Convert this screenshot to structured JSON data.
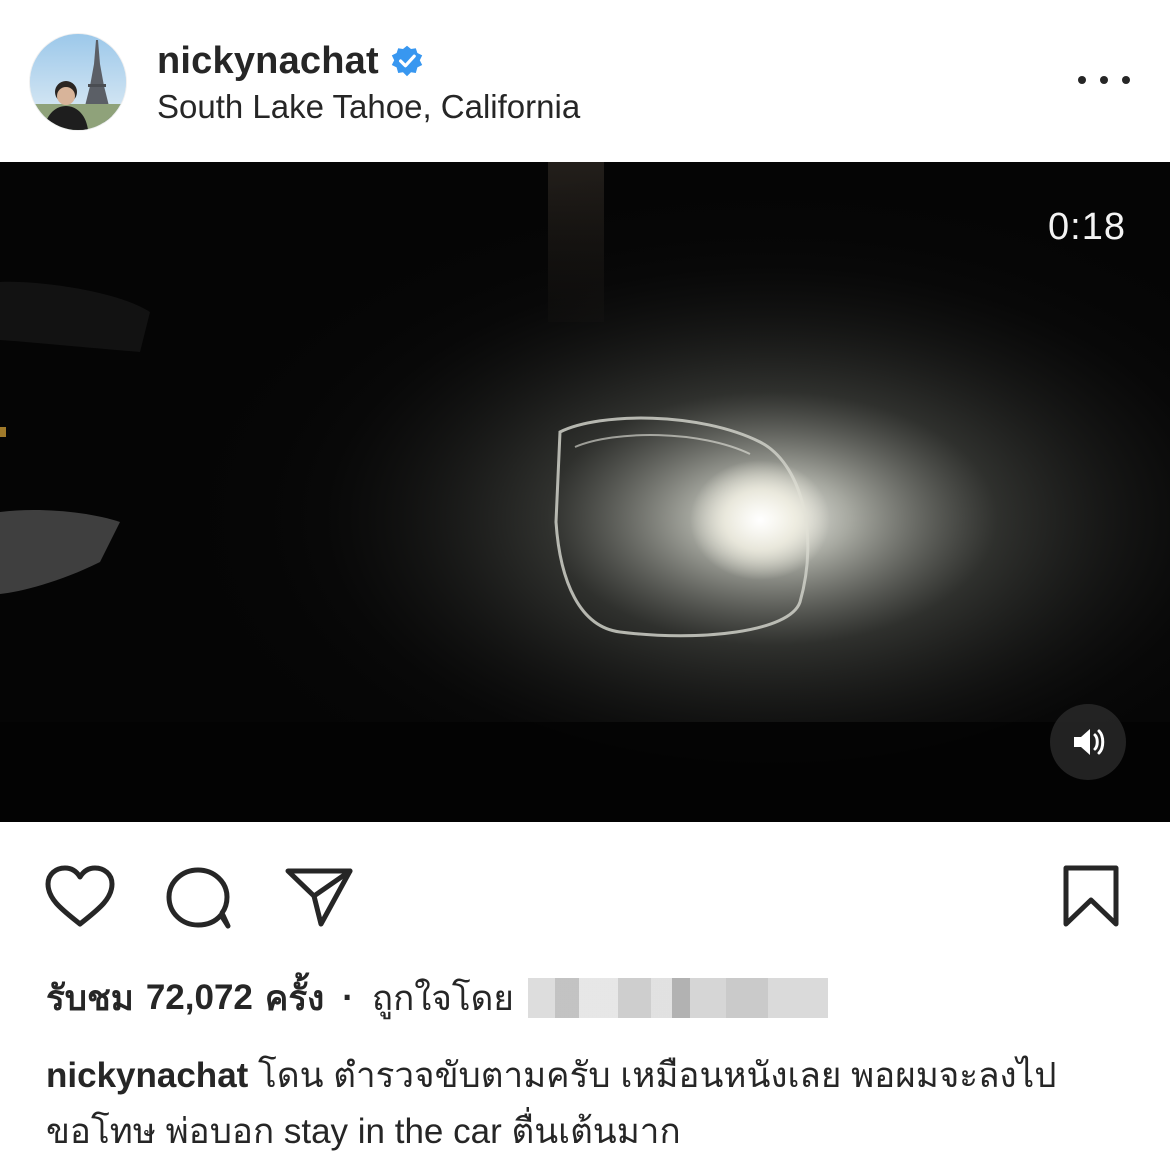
{
  "post": {
    "username": "nickynachat",
    "location": "South Lake Tahoe, California",
    "verified": true,
    "more_icon": "more-horizontal-icon"
  },
  "video": {
    "time_remaining": "0:18",
    "sound_icon": "speaker-on-icon"
  },
  "actions": {
    "like_icon": "heart-icon",
    "comment_icon": "comment-icon",
    "share_icon": "paper-plane-icon",
    "save_icon": "bookmark-icon"
  },
  "stats": {
    "views_prefix": "รับชม",
    "views_count": "72,072",
    "views_suffix": "ครั้ง",
    "separator": "·",
    "liked_by_label": "ถูกใจโดย"
  },
  "caption": {
    "username": "nickynachat",
    "text": "โดน ตำรวจขับตามครับ เหมือนหนังเลย พอผมจะลงไปขอโทษ พ่อบอก stay in the car ตื่นเต้นมาก"
  },
  "colors": {
    "text": "#262626",
    "verified_badge": "#3897f0",
    "video_background": "#050505"
  }
}
